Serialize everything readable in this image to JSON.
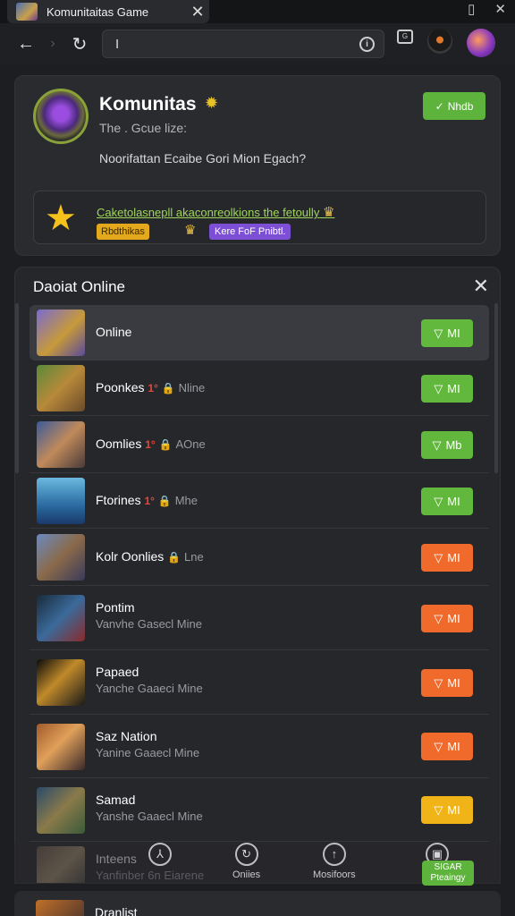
{
  "browser": {
    "tab_title": "Komunitaitas Game",
    "tab_close": "✕",
    "url_text": "I",
    "window_icons": [
      "▯",
      "✕"
    ],
    "ext_label": "G"
  },
  "community": {
    "name": "Komunitas",
    "subtitle": "The . Gcue lize:",
    "description": "Noorifattan Ecaibe Gori Mion Egach?",
    "button_label": "Nhdb",
    "promo_text": "Caketolasnepll akaconreolkions the fetoully",
    "promo_badge_1": "Rbdthikas",
    "promo_badge_2": "Kere FoF Pnibtl."
  },
  "panel": {
    "title": "Daoiat Online",
    "close": "✕",
    "rows": [
      {
        "name": "Online",
        "sub": "",
        "fire": "",
        "lock": "",
        "tail": "",
        "btn": "MI",
        "color": "green",
        "h": 62,
        "selected": true
      },
      {
        "name": "Poonkes",
        "sub": "",
        "fire": "1°",
        "lock": "🔒",
        "tail": "Nline",
        "btn": "MI",
        "color": "green",
        "h": 62
      },
      {
        "name": "Oomlies",
        "sub": "",
        "fire": "1°",
        "lock": "🔒",
        "tail": "AOne",
        "btn": "Mb",
        "color": "green",
        "h": 64
      },
      {
        "name": "Ftorines",
        "sub": "",
        "fire": "1°",
        "lock": "🔒",
        "tail": "Mhe",
        "btn": "MI",
        "color": "green",
        "h": 62
      },
      {
        "name": "Kolr Oonlies",
        "sub": "",
        "fire": "",
        "lock": "🔒",
        "tail": "Lne",
        "btn": "MI",
        "color": "orange",
        "h": 64
      },
      {
        "name": "Pontim",
        "sub": "Vanvhe Gasecl Mine",
        "fire": "",
        "lock": "",
        "tail": "",
        "btn": "MI",
        "color": "orange",
        "h": 72
      },
      {
        "name": "Papaed",
        "sub": "Yanche Gaaeci Mine",
        "fire": "",
        "lock": "",
        "tail": "",
        "btn": "MI",
        "color": "orange",
        "h": 72
      },
      {
        "name": "Saz Nation",
        "sub": "Yanine Gaaecl Mine",
        "fire": "",
        "lock": "",
        "tail": "",
        "btn": "MI",
        "color": "orange",
        "h": 71
      },
      {
        "name": "Samad",
        "sub": "Yanshe Gaaecl Mine",
        "fire": "",
        "lock": "",
        "tail": "",
        "btn": "MI",
        "color": "yellow",
        "h": 71
      },
      {
        "name": "Inteens",
        "sub": "Yanfinber 6n Eiarene",
        "fire": "",
        "lock": "",
        "tail": "",
        "btn": "",
        "color": "green",
        "h": 62
      }
    ]
  },
  "bottom_nav": {
    "items": [
      {
        "label": "",
        "icon": "⅄"
      },
      {
        "label": "Oniies",
        "icon": "↻"
      },
      {
        "label": "Mosifoors",
        "icon": "↑"
      },
      {
        "label": "",
        "icon": "▣"
      }
    ],
    "button_label": "SIGAR Pteaingy"
  },
  "next_item": {
    "label": "Dranlist"
  },
  "colors": {
    "green": "#62b83c",
    "orange": "#f06a2b",
    "yellow": "#f0b419",
    "accent": "#7d4fd6"
  }
}
